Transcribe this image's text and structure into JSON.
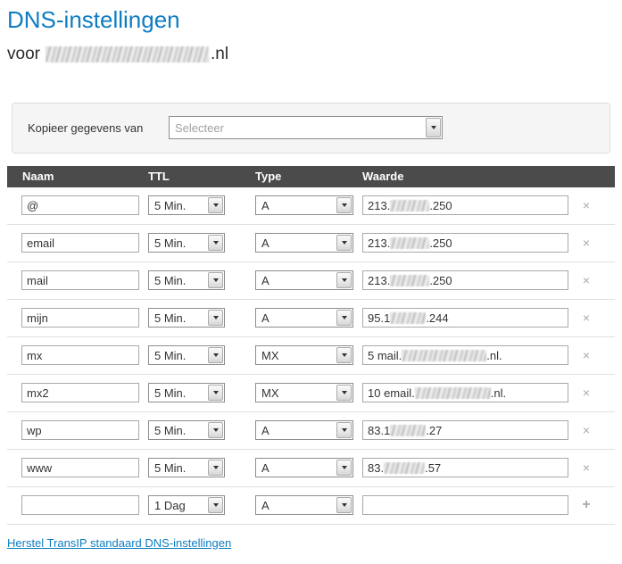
{
  "page": {
    "title": "DNS-instellingen",
    "subtitle_prefix": "voor",
    "subtitle_suffix": ".nl",
    "domain_redacted": true
  },
  "copy_section": {
    "label": "Kopieer gegevens van",
    "select_value": "Selecteer"
  },
  "table": {
    "headers": [
      "Naam",
      "TTL",
      "Type",
      "Waarde"
    ],
    "rows": [
      {
        "naam": "@",
        "ttl": "5 Min.",
        "type": "A",
        "waarde_prefix": "213.",
        "waarde_suffix": ".250",
        "redact_width": 44,
        "action": "delete"
      },
      {
        "naam": "email",
        "ttl": "5 Min.",
        "type": "A",
        "waarde_prefix": "213.",
        "waarde_suffix": ".250",
        "redact_width": 44,
        "action": "delete"
      },
      {
        "naam": "mail",
        "ttl": "5 Min.",
        "type": "A",
        "waarde_prefix": "213.",
        "waarde_suffix": ".250",
        "redact_width": 44,
        "action": "delete"
      },
      {
        "naam": "mijn",
        "ttl": "5 Min.",
        "type": "A",
        "waarde_prefix": "95.1",
        "waarde_suffix": ".244",
        "redact_width": 40,
        "action": "delete"
      },
      {
        "naam": "mx",
        "ttl": "5 Min.",
        "type": "MX",
        "waarde_prefix": "5 mail.",
        "waarde_suffix": ".nl.",
        "redact_width": 95,
        "action": "delete"
      },
      {
        "naam": "mx2",
        "ttl": "5 Min.",
        "type": "MX",
        "waarde_prefix": "10 email.",
        "waarde_suffix": ".nl.",
        "redact_width": 85,
        "action": "delete"
      },
      {
        "naam": "wp",
        "ttl": "5 Min.",
        "type": "A",
        "waarde_prefix": "83.1",
        "waarde_suffix": ".27",
        "redact_width": 40,
        "action": "delete"
      },
      {
        "naam": "www",
        "ttl": "5 Min.",
        "type": "A",
        "waarde_prefix": "83.",
        "waarde_suffix": ".57",
        "redact_width": 46,
        "action": "delete"
      },
      {
        "naam": "",
        "ttl": "1 Dag",
        "type": "A",
        "waarde_prefix": "",
        "waarde_suffix": "",
        "redact_width": 0,
        "action": "add"
      }
    ]
  },
  "footer": {
    "reset_link": "Herstel TransIP standaard DNS-instellingen"
  },
  "icons": {
    "delete": "×",
    "add": "+",
    "dropdown": "chevron-down"
  },
  "colors": {
    "accent_blue": "#0e7dc1",
    "table_header_bg": "#4b4b4b"
  }
}
